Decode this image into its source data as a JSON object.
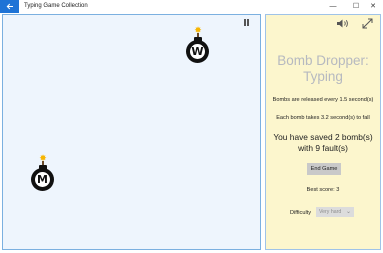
{
  "window": {
    "title": "Typing Game Collection",
    "back_icon": "back-arrow-icon",
    "minimize_glyph": "—",
    "maximize_glyph": "☐",
    "close_glyph": "✕"
  },
  "game": {
    "pause_icon": "pause-icon",
    "bombs": [
      {
        "letter": "W"
      },
      {
        "letter": "M"
      }
    ]
  },
  "panel": {
    "sound_icon": "speaker-icon",
    "expand_icon": "expand-icon",
    "title": "Bomb Dropper: Typing",
    "release_info": "Bombs are released every 1.5 second(s)",
    "fall_info": "Each bomb takes 3.2 second(s) to fall",
    "saved_text": "You have saved 2 bomb(s) with 9 fault(s)",
    "end_button": "End Game",
    "best_score": "Best score: 3",
    "difficulty_label": "Difficulty",
    "difficulty_value": "Very hard",
    "chevron": "⌄"
  },
  "colors": {
    "accent": "#1e73d6",
    "game_bg": "#eef5fd",
    "panel_bg": "#fcf6cd",
    "title_text": "#b6b9c0"
  }
}
